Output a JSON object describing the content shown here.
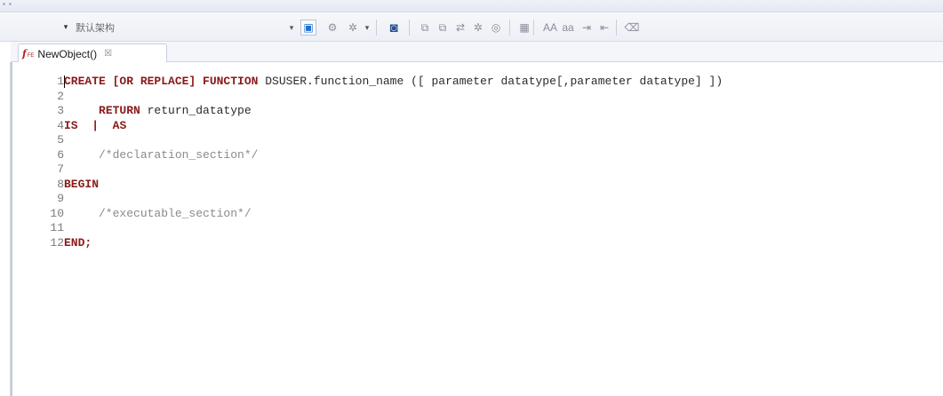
{
  "toolbar": {
    "schema_value": "默认架构",
    "schema_arrow": "▾",
    "buttons": [
      {
        "name": "execute-dropdown-arrow",
        "glyph": "▾"
      },
      {
        "name": "run-icon",
        "glyph": "▣"
      },
      {
        "name": "settings-icon",
        "glyph": "⚙"
      },
      {
        "name": "debug-icon",
        "glyph": "✲"
      },
      {
        "name": "debug-dropdown-arrow",
        "glyph": "▾"
      },
      {
        "name": "compile-icon",
        "glyph": "◙"
      },
      {
        "name": "copy-icon",
        "glyph": "⧉"
      },
      {
        "name": "copy-alt-icon",
        "glyph": "⧉"
      },
      {
        "name": "step-icon",
        "glyph": "⇄"
      },
      {
        "name": "gear-bug-icon",
        "glyph": "✲"
      },
      {
        "name": "target-icon",
        "glyph": "◎"
      },
      {
        "name": "format-icon",
        "glyph": "▦"
      },
      {
        "name": "uppercase-icon",
        "glyph": "AA"
      },
      {
        "name": "lowercase-icon",
        "glyph": "aa"
      },
      {
        "name": "indent-icon",
        "glyph": "⇥"
      },
      {
        "name": "outdent-icon",
        "glyph": "⇤"
      },
      {
        "name": "clear-icon",
        "glyph": "⌫"
      }
    ]
  },
  "tab": {
    "icon_letter": "f",
    "icon_sub": "FE",
    "label": "NewObject()",
    "close_glyph": "☒"
  },
  "editor": {
    "lines": [
      {
        "n": "1",
        "parts": [
          {
            "t": "CREATE",
            "c": "kw"
          },
          {
            "t": " [OR REPLACE] ",
            "c": "kw"
          },
          {
            "t": "FUNCTION",
            "c": "kw"
          },
          {
            "t": " DSUSER.function_name ([ parameter datatype[,parameter datatype] ])",
            "c": "txt"
          }
        ]
      },
      {
        "n": "2",
        "parts": []
      },
      {
        "n": "3",
        "parts": [
          {
            "t": "     ",
            "c": "txt"
          },
          {
            "t": "RETURN",
            "c": "kw"
          },
          {
            "t": " return_datatype",
            "c": "txt"
          }
        ]
      },
      {
        "n": "4",
        "parts": [
          {
            "t": "IS",
            "c": "kw"
          },
          {
            "t": "  ",
            "c": "txt"
          },
          {
            "t": "|",
            "c": "kw"
          },
          {
            "t": "  ",
            "c": "txt"
          },
          {
            "t": "AS",
            "c": "kw"
          }
        ]
      },
      {
        "n": "5",
        "parts": []
      },
      {
        "n": "6",
        "parts": [
          {
            "t": "     /*declaration_section*/",
            "c": "cm"
          }
        ]
      },
      {
        "n": "7",
        "parts": []
      },
      {
        "n": "8",
        "parts": [
          {
            "t": "BEGIN",
            "c": "kw"
          }
        ]
      },
      {
        "n": "9",
        "parts": []
      },
      {
        "n": "10",
        "parts": [
          {
            "t": "     /*executable_section*/",
            "c": "cm"
          }
        ]
      },
      {
        "n": "11",
        "parts": []
      },
      {
        "n": "12",
        "parts": [
          {
            "t": "END;",
            "c": "kw"
          }
        ]
      }
    ]
  }
}
